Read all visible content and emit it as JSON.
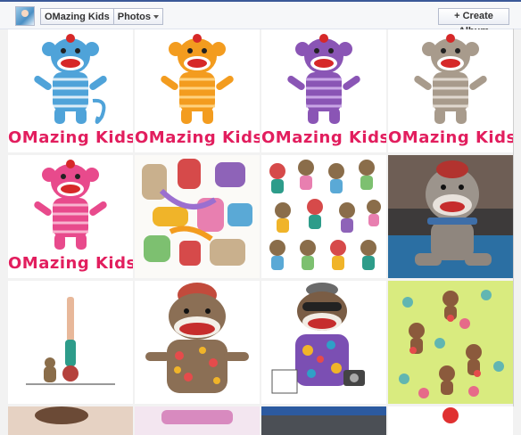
{
  "header": {
    "breadcrumb_name": "OMazing Kids",
    "breadcrumb_section": "Photos",
    "create_album": "+ Create Album"
  },
  "photos": [
    {
      "caption": "OMazing Kids",
      "color": "#4fa3d9"
    },
    {
      "caption": "OMazing Kids",
      "color": "#f39c1f"
    },
    {
      "caption": "OMazing Kids",
      "color": "#8a55b5"
    },
    {
      "caption": "OMazing Kids",
      "color": "#a89b8c"
    },
    {
      "caption": "OMazing Kids",
      "color": "#e84a8c"
    }
  ],
  "colors": {
    "brand_pink": "#e21e5e",
    "facebook_blue": "#3b5998"
  }
}
